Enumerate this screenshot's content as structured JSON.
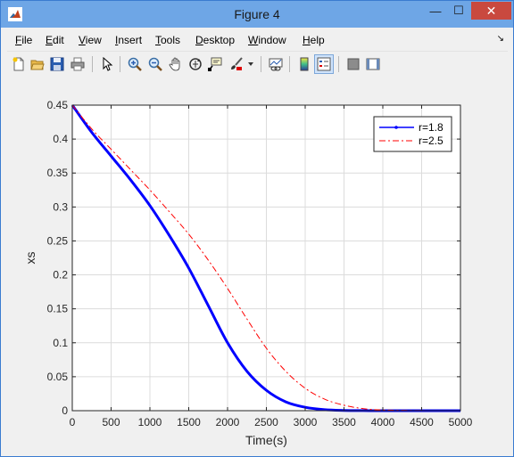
{
  "window": {
    "title": "Figure 4",
    "minimize_glyph": "—",
    "maximize_glyph": "☐",
    "close_glyph": "✕"
  },
  "menu": {
    "items": [
      {
        "label": "File",
        "key": "F",
        "rest": "ile"
      },
      {
        "label": "Edit",
        "key": "E",
        "rest": "dit"
      },
      {
        "label": "View",
        "key": "V",
        "rest": "iew"
      },
      {
        "label": "Insert",
        "key": "I",
        "rest": "nsert"
      },
      {
        "label": "Tools",
        "key": "T",
        "rest": "ools"
      },
      {
        "label": "Desktop",
        "key": "D",
        "rest": "esktop"
      },
      {
        "label": "Window",
        "key": "W",
        "rest": "indow"
      },
      {
        "label": "Help",
        "key": "H",
        "rest": "elp"
      }
    ],
    "dock_glyph": "↘"
  },
  "toolbar": {
    "buttons": [
      {
        "name": "new-figure-button",
        "icon": "new-figure-icon"
      },
      {
        "name": "open-file-button",
        "icon": "open-folder-icon"
      },
      {
        "name": "save-button",
        "icon": "save-icon"
      },
      {
        "name": "print-button",
        "icon": "print-icon"
      },
      {
        "name": "edit-plot-button",
        "icon": "pointer-arrow-icon"
      },
      {
        "name": "zoom-in-button",
        "icon": "zoom-in-icon"
      },
      {
        "name": "zoom-out-button",
        "icon": "zoom-out-icon"
      },
      {
        "name": "pan-button",
        "icon": "pan-hand-icon"
      },
      {
        "name": "rotate-3d-button",
        "icon": "rotate-3d-icon"
      },
      {
        "name": "data-cursor-button",
        "icon": "data-cursor-icon"
      },
      {
        "name": "brush-button",
        "icon": "brush-icon"
      },
      {
        "name": "brush-dropdown-button",
        "icon": "dropdown-arrow-icon"
      },
      {
        "name": "link-plot-button",
        "icon": "link-plot-icon"
      },
      {
        "name": "insert-colorbar-button",
        "icon": "colorbar-icon"
      },
      {
        "name": "insert-legend-button",
        "icon": "legend-icon"
      },
      {
        "name": "hide-plot-tools-button",
        "icon": "hide-plot-tools-icon"
      },
      {
        "name": "show-plot-tools-button",
        "icon": "show-plot-tools-icon"
      }
    ]
  },
  "chart_data": {
    "type": "line",
    "title": "",
    "xlabel": "Time(s)",
    "ylabel": "xs",
    "xlim": [
      0,
      5000
    ],
    "ylim": [
      0,
      0.45
    ],
    "xticks": [
      0,
      500,
      1000,
      1500,
      2000,
      2500,
      3000,
      3500,
      4000,
      4500,
      5000
    ],
    "yticks": [
      0,
      0.05,
      0.1,
      0.15,
      0.2,
      0.25,
      0.3,
      0.35,
      0.4,
      0.45
    ],
    "xtick_labels": [
      "0",
      "500",
      "1000",
      "1500",
      "2000",
      "2500",
      "3000",
      "3500",
      "4000",
      "4500",
      "5000"
    ],
    "ytick_labels": [
      "0",
      "0.05",
      "0.1",
      "0.15",
      "0.2",
      "0.25",
      "0.3",
      "0.35",
      "0.4",
      "0.45"
    ],
    "grid": true,
    "legend_position": "top-right",
    "series": [
      {
        "name": "r=1.8",
        "color": "#0000ff",
        "style": "solid-thick-dot-marker",
        "x": [
          0,
          250,
          500,
          750,
          1000,
          1250,
          1500,
          1750,
          2000,
          2250,
          2500,
          2750,
          3000,
          3250,
          3500,
          3750,
          4000,
          4500,
          5000
        ],
        "y": [
          0.45,
          0.41,
          0.375,
          0.34,
          0.302,
          0.258,
          0.21,
          0.155,
          0.1,
          0.058,
          0.03,
          0.013,
          0.005,
          0.0015,
          0.0004,
          0.0001,
          0,
          0,
          0
        ]
      },
      {
        "name": "r=2.5",
        "color": "#ff0000",
        "style": "dash-dot",
        "x": [
          0,
          250,
          500,
          750,
          1000,
          1250,
          1500,
          1750,
          2000,
          2250,
          2500,
          2750,
          3000,
          3250,
          3500,
          3750,
          4000,
          4500,
          5000
        ],
        "y": [
          0.45,
          0.415,
          0.385,
          0.355,
          0.325,
          0.293,
          0.26,
          0.222,
          0.18,
          0.135,
          0.092,
          0.058,
          0.033,
          0.017,
          0.008,
          0.003,
          0.001,
          0.0001,
          0
        ]
      }
    ]
  }
}
